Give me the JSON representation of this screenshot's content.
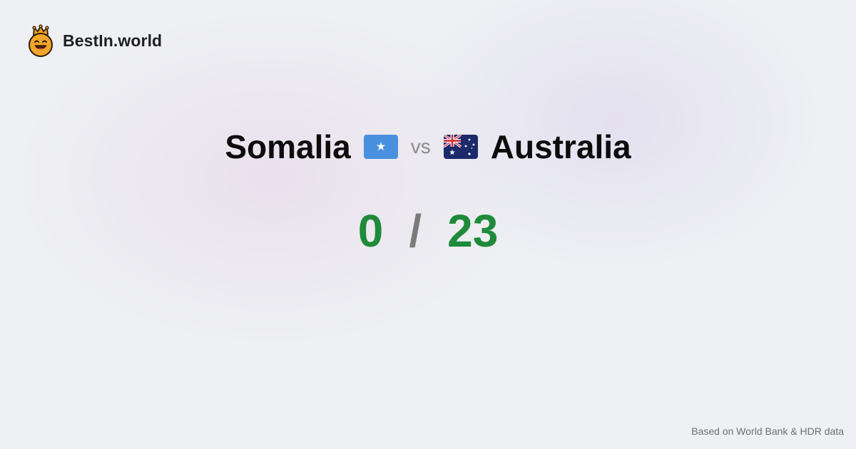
{
  "brand": {
    "name": "BestIn.world",
    "logo_icon": "crown-smiley-icon"
  },
  "matchup": {
    "left_country": "Somalia",
    "left_flag": "somalia-flag-icon",
    "vs_label": "vs",
    "right_country": "Australia",
    "right_flag": "australia-flag-icon"
  },
  "score": {
    "left": "0",
    "separator": "/",
    "right": "23",
    "color": "#1e8a3a"
  },
  "footer": {
    "source": "Based on World Bank & HDR data"
  }
}
